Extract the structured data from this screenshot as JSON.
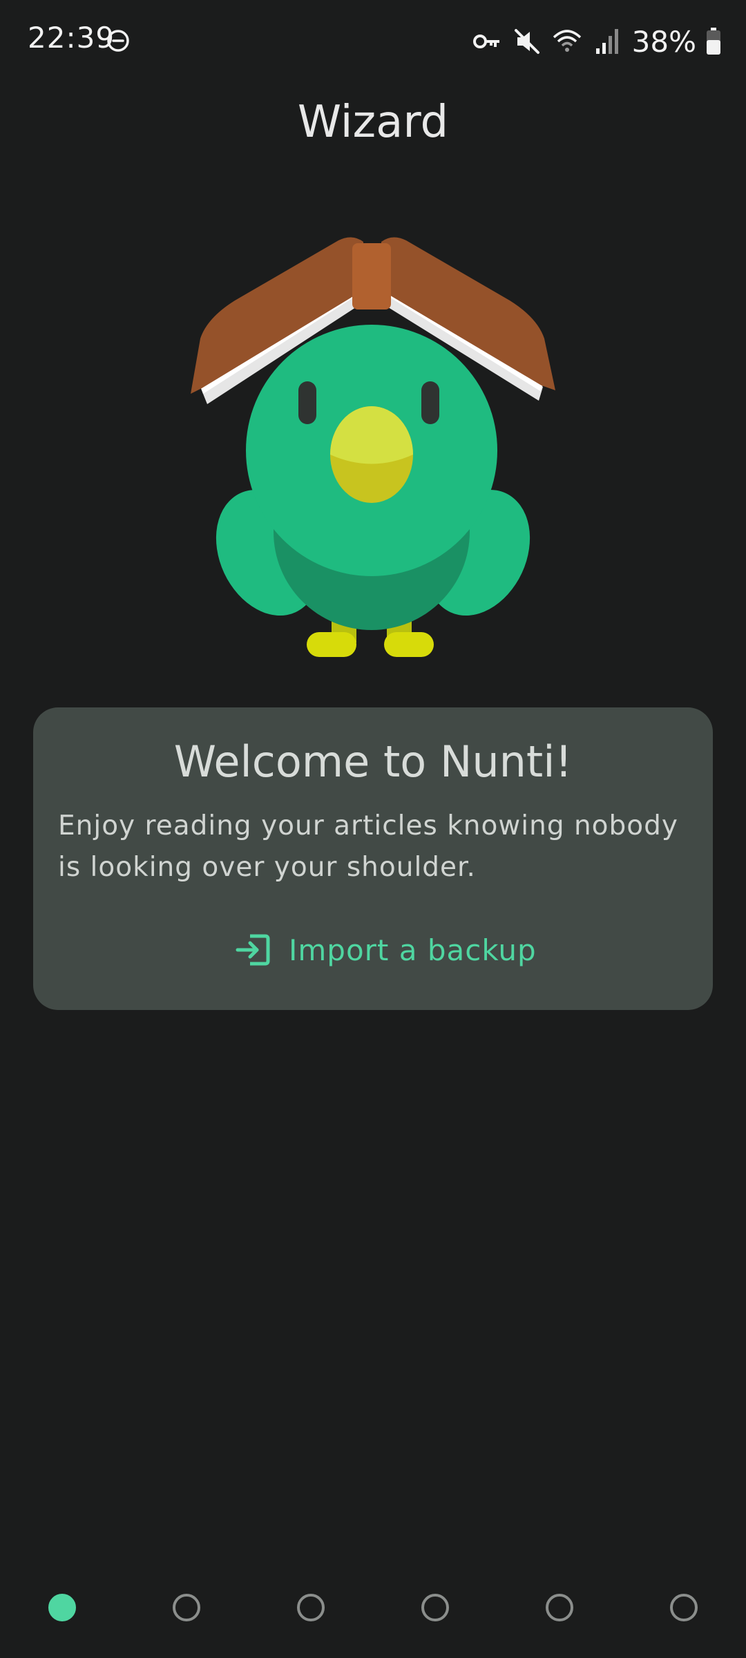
{
  "status_bar": {
    "time": "22:39",
    "battery_percent": "38%",
    "icons": [
      "do-not-disturb-icon",
      "vpn-key-icon",
      "mute-icon",
      "wifi-icon",
      "signal-icon",
      "battery-icon"
    ]
  },
  "header": {
    "title": "Wizard"
  },
  "welcome": {
    "title": "Welcome to Nunti!",
    "body": "Enjoy reading your articles knowing nobody is looking over your shoulder.",
    "import_label": "Import a backup",
    "import_icon": "import-icon"
  },
  "pager": {
    "total_pages": 6,
    "active_index": 0
  },
  "colors": {
    "background": "#1b1c1c",
    "card": "#424a46",
    "accent": "#4fd6a1",
    "mascot_body": "#1fbb80",
    "mascot_belly": "#1a9164",
    "roof": "#95522a",
    "beak": "#d4e042"
  }
}
